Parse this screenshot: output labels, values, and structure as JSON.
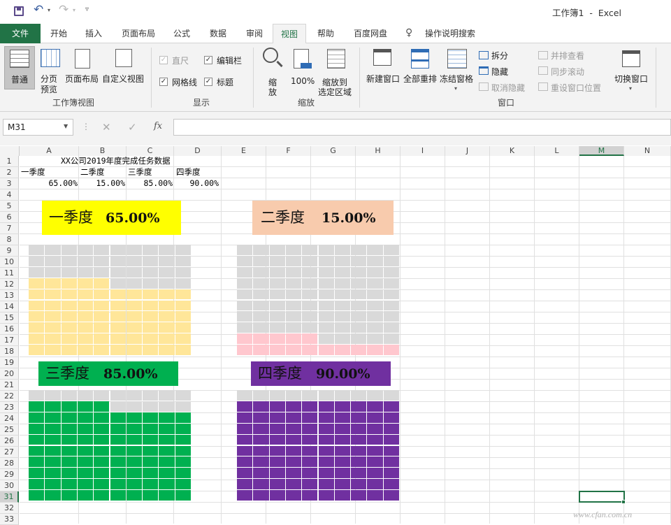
{
  "window": {
    "title": "工作簿1  -  Excel"
  },
  "qat": {
    "save_icon": "save-icon",
    "undo_icon": "undo-icon",
    "redo_icon": "redo-icon",
    "customize_icon": "customize-qat-icon"
  },
  "tabs": [
    {
      "label": "文件"
    },
    {
      "label": "开始"
    },
    {
      "label": "插入"
    },
    {
      "label": "页面布局"
    },
    {
      "label": "公式"
    },
    {
      "label": "数据"
    },
    {
      "label": "审阅"
    },
    {
      "label": "视图"
    },
    {
      "label": "帮助"
    },
    {
      "label": "百度网盘"
    },
    {
      "label": "操作说明搜索"
    }
  ],
  "ribbon": {
    "workbook_views": {
      "group_label": "工作簿视图",
      "normal": "普通",
      "page_break_1": "分页",
      "page_break_2": "预览",
      "page_layout": "页面布局",
      "custom_view": "自定义视图"
    },
    "show": {
      "group_label": "显示",
      "ruler": "直尺",
      "formula_bar": "编辑栏",
      "gridlines": "网格线",
      "headings": "标题"
    },
    "zoom": {
      "group_label": "缩放",
      "zoom_1": "缩",
      "zoom_2": "放",
      "zoom_100": "100%",
      "zoom_sel_1": "缩放到",
      "zoom_sel_2": "选定区域"
    },
    "window": {
      "group_label": "窗口",
      "new_window": "新建窗口",
      "arrange_all": "全部重排",
      "freeze": "冻结窗格",
      "split": "拆分",
      "hide": "隐藏",
      "unhide": "取消隐藏",
      "side_by_side": "并排查看",
      "sync_scroll": "同步滚动",
      "reset_pos": "重设窗口位置",
      "switch": "切换窗口"
    }
  },
  "formula_bar": {
    "name_box": "M31",
    "fx": "fx",
    "content": ""
  },
  "columns": [
    "A",
    "B",
    "C",
    "D",
    "E",
    "F",
    "G",
    "H",
    "I",
    "J",
    "K",
    "L",
    "M",
    "N"
  ],
  "rows": [
    "1",
    "2",
    "3",
    "4",
    "5",
    "6",
    "7",
    "8",
    "9",
    "10",
    "11",
    "12",
    "13",
    "14",
    "15",
    "16",
    "17",
    "18",
    "19",
    "20",
    "21",
    "22",
    "23",
    "24",
    "25",
    "26",
    "27",
    "28",
    "29",
    "30",
    "31",
    "32",
    "33"
  ],
  "cells": {
    "a1": "XX公司2019年度完成任务数据",
    "headers": [
      "一季度",
      "二季度",
      "三季度",
      "四季度"
    ],
    "values": [
      "65.00%",
      "15.00%",
      "85.00%",
      "90.00%"
    ]
  },
  "quarters": [
    {
      "label": "一季度",
      "value": "65.00%",
      "label_bg": "#ffff00",
      "fill": "#ffe699",
      "empty": "#d9d9d9",
      "fraction": 0.65
    },
    {
      "label": "二季度",
      "value": "15.00%",
      "label_bg": "#f8cbad",
      "fill": "#ffc7ce",
      "empty": "#d9d9d9",
      "fraction": 0.15
    },
    {
      "label": "三季度",
      "value": "85.00%",
      "label_bg": "#00b050",
      "fill": "#00b050",
      "empty": "#d9d9d9",
      "fraction": 0.85
    },
    {
      "label": "四季度",
      "value": "90.00%",
      "label_bg": "#7030a0",
      "fill": "#7030a0",
      "empty": "#d9d9d9",
      "fraction": 0.9
    }
  ],
  "colors": {
    "file_tab": "#217346",
    "accent": "#217346",
    "selected_cell": "#217346"
  },
  "watermark": "www.cfan.com.cn"
}
